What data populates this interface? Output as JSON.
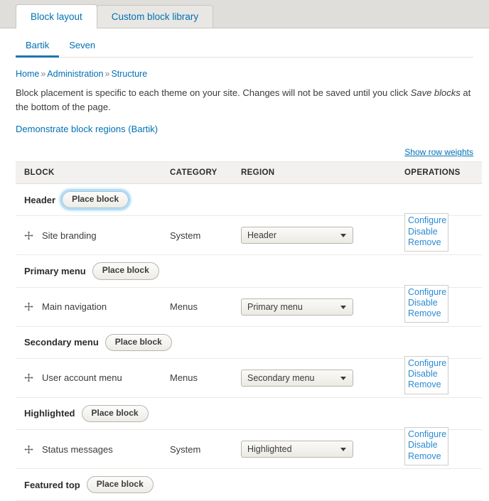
{
  "primary_tabs": [
    {
      "label": "Block layout",
      "active": true
    },
    {
      "label": "Custom block library",
      "active": false
    }
  ],
  "secondary_tabs": [
    {
      "label": "Bartik",
      "active": true
    },
    {
      "label": "Seven",
      "active": false
    }
  ],
  "breadcrumb": {
    "items": [
      "Home",
      "Administration",
      "Structure"
    ],
    "separator": "»"
  },
  "intro": {
    "text_before": "Block placement is specific to each theme on your site. Changes will not be saved until you click ",
    "emphasis": "Save blocks",
    "text_after": " at the bottom of the page."
  },
  "demonstrate_link": "Demonstrate block regions (Bartik)",
  "show_row_weights": "Show row weights",
  "table": {
    "headers": {
      "block": "BLOCK",
      "category": "CATEGORY",
      "region": "REGION",
      "operations": "OPERATIONS"
    },
    "place_block_label": "Place block",
    "operations_labels": {
      "configure": "Configure",
      "disable": "Disable",
      "remove": "Remove"
    },
    "rows": [
      {
        "kind": "region",
        "region_name": "Header",
        "focused": true
      },
      {
        "kind": "block",
        "title": "Site branding",
        "category": "System",
        "region_value": "Header"
      },
      {
        "kind": "region",
        "region_name": "Primary menu",
        "focused": false
      },
      {
        "kind": "block",
        "title": "Main navigation",
        "category": "Menus",
        "region_value": "Primary menu"
      },
      {
        "kind": "region",
        "region_name": "Secondary menu",
        "focused": false
      },
      {
        "kind": "block",
        "title": "User account menu",
        "category": "Menus",
        "region_value": "Secondary menu"
      },
      {
        "kind": "region",
        "region_name": "Highlighted",
        "focused": false
      },
      {
        "kind": "block",
        "title": "Status messages",
        "category": "System",
        "region_value": "Highlighted"
      },
      {
        "kind": "region",
        "region_name": "Featured top",
        "focused": false
      }
    ]
  },
  "colors": {
    "tabbar_bg": "#dfdedb",
    "link": "#0071b3",
    "active_underline": "#1e75b3",
    "ops_link": "#2b8ad4",
    "table_header_bg": "#f2f1ef"
  }
}
